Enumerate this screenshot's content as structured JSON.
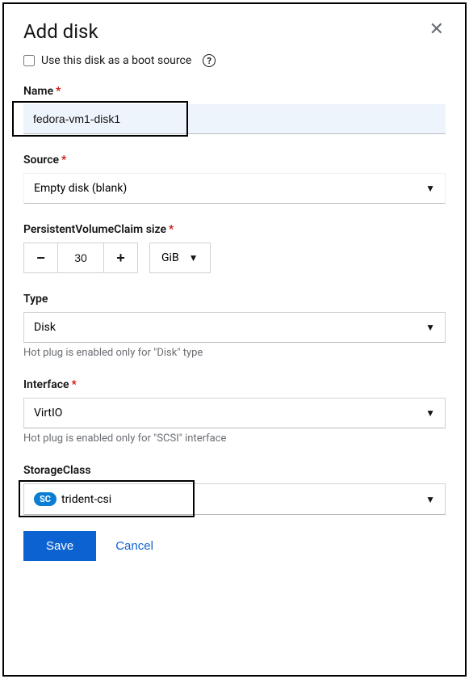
{
  "modal": {
    "title": "Add disk",
    "boot_source_label": "Use this disk as a boot source"
  },
  "name": {
    "label": "Name",
    "value": "fedora-vm1-disk1"
  },
  "source": {
    "label": "Source",
    "value": "Empty disk (blank)"
  },
  "pvc_size": {
    "label": "PersistentVolumeClaim size",
    "value": "30",
    "unit": "GiB"
  },
  "type": {
    "label": "Type",
    "value": "Disk",
    "helper": "Hot plug is enabled only for \"Disk\" type"
  },
  "interface": {
    "label": "Interface",
    "value": "VirtIO",
    "helper": "Hot plug is enabled only for \"SCSI\" interface"
  },
  "storage_class": {
    "label": "StorageClass",
    "badge": "SC",
    "value": "trident-csi"
  },
  "actions": {
    "save": "Save",
    "cancel": "Cancel"
  }
}
